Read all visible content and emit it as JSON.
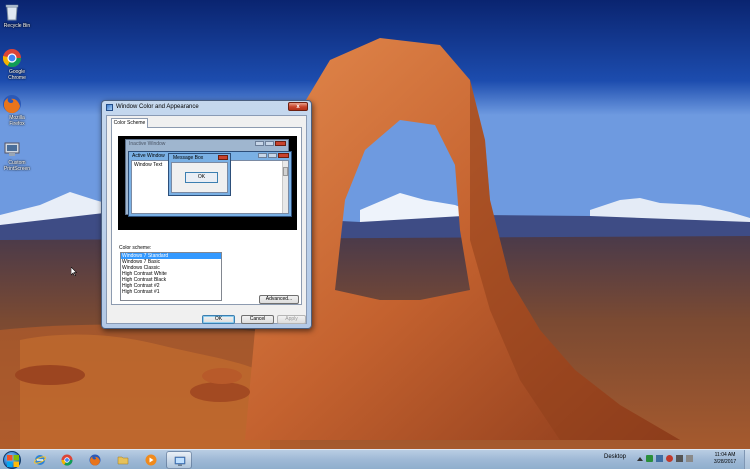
{
  "desktop": {
    "icons": [
      {
        "label": "Recycle Bin",
        "icon": "recycle-bin-icon"
      },
      {
        "label": "Google Chrome",
        "icon": "chrome-icon"
      },
      {
        "label": "Mozilla Firefox",
        "icon": "firefox-icon"
      },
      {
        "label": "Custom PrintScreen",
        "icon": "printscreen-icon"
      }
    ]
  },
  "dialog": {
    "title": "Window Color and Appearance",
    "close_glyph": "x",
    "tab_label": "Color Scheme",
    "preview": {
      "inactive_title": "Inactive Window",
      "active_title": "Active Window",
      "window_text": "Window Text",
      "message_box_title": "Message Box",
      "message_box_ok": "OK"
    },
    "color_scheme_label": "Color scheme:",
    "schemes": [
      "Windows 7 Standard",
      "Windows 7 Basic",
      "Windows Classic",
      "High Contrast White",
      "High Contrast Black",
      "High Contrast #2",
      "High Contrast #1"
    ],
    "selected_scheme": "Windows 7 Standard",
    "advanced_label": "Advanced...",
    "ok_label": "OK",
    "cancel_label": "Cancel",
    "apply_label": "Apply"
  },
  "taskbar": {
    "pinned": [
      {
        "icon": "internet-explorer-icon"
      },
      {
        "icon": "chrome-icon"
      },
      {
        "icon": "firefox-icon"
      },
      {
        "icon": "folder-icon"
      },
      {
        "icon": "media-player-icon"
      },
      {
        "icon": "control-panel-icon",
        "active": true
      }
    ],
    "desktop_toolbar_label": "Desktop",
    "clock_time": "11:04 AM",
    "clock_date": "3/28/2017"
  },
  "colors": {
    "selection": "#3399ff",
    "active_caption": "#7ab0e4",
    "close_red": "#c7432a"
  }
}
